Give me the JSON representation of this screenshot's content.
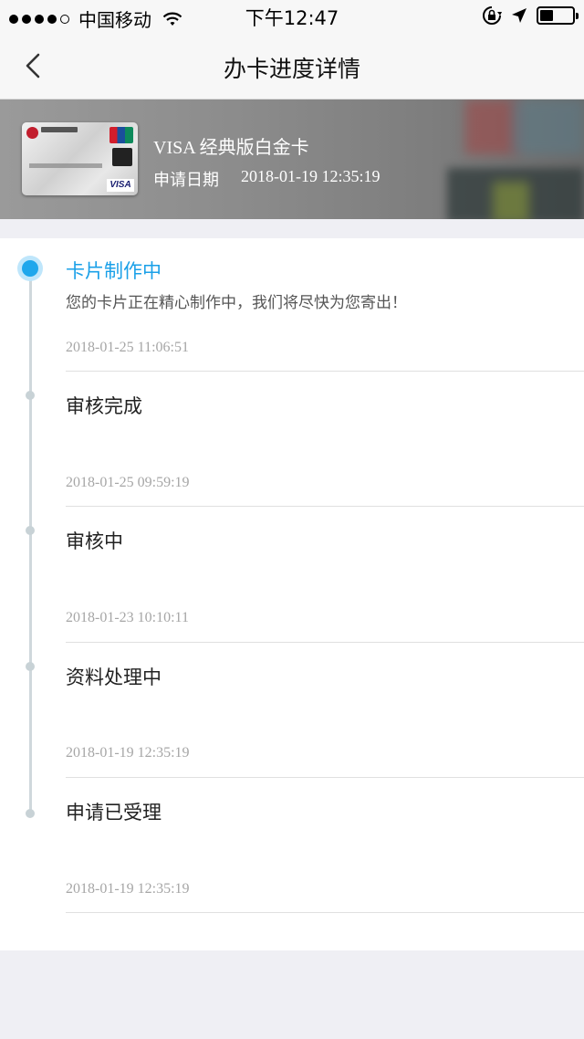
{
  "status_bar": {
    "carrier": "中国移动",
    "time": "下午12:47",
    "battery_level": 0.4,
    "icons": [
      "signal-dots",
      "wifi-icon",
      "rotation-lock-icon",
      "location-icon",
      "battery-icon"
    ]
  },
  "nav": {
    "title": "办卡进度详情",
    "back_icon": "chevron-left-icon"
  },
  "card": {
    "name": "VISA 经典版白金卡",
    "apply_label": "申请日期",
    "apply_date": "2018-01-19 12:35:19"
  },
  "timeline": {
    "accent_color": "#1aa0e8",
    "items": [
      {
        "title": "卡片制作中",
        "desc": "您的卡片正在精心制作中，我们将尽快为您寄出！",
        "time": "2018-01-25 11:06:51",
        "active": true
      },
      {
        "title": "审核完成",
        "time": "2018-01-25 09:59:19",
        "active": false
      },
      {
        "title": "审核中",
        "time": "2018-01-23 10:10:11",
        "active": false
      },
      {
        "title": "资料处理中",
        "time": "2018-01-19 12:35:19",
        "active": false
      },
      {
        "title": "申请已受理",
        "time": "2018-01-19 12:35:19",
        "active": false
      }
    ]
  }
}
